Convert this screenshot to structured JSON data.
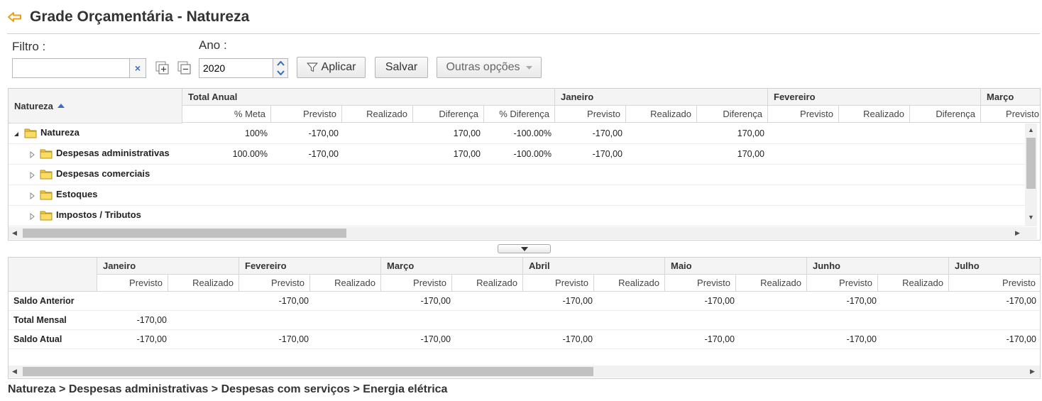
{
  "header": {
    "title": "Grade Orçamentária - Natureza",
    "back_icon": "back-arrow-icon"
  },
  "toolbar": {
    "filter_label": "Filtro :",
    "filter_value": "",
    "clear_glyph": "×",
    "year_label": "Ano :",
    "year_value": "2020",
    "apply_label": "Aplicar",
    "save_label": "Salvar",
    "other_label": "Outras opções"
  },
  "top_grid": {
    "col_natureza": "Natureza",
    "months": [
      "Total Anual",
      "Janeiro",
      "Fevereiro",
      "Março"
    ],
    "sub_total": [
      "% Meta",
      "Previsto",
      "Realizado",
      "Diferença",
      "% Diferença"
    ],
    "sub_month": [
      "Previsto",
      "Realizado",
      "Diferença"
    ],
    "rows": [
      {
        "label": "Natureza",
        "meta": "100%",
        "previsto": "-170,00",
        "realizado": "",
        "diferenca": "170,00",
        "pct_dif": "-100.00%",
        "jan_prev": "-170,00",
        "jan_real": "",
        "jan_dif": "170,00"
      },
      {
        "label": "Despesas administrativas",
        "meta": "100.00%",
        "previsto": "-170,00",
        "realizado": "",
        "diferenca": "170,00",
        "pct_dif": "-100.00%",
        "jan_prev": "-170,00",
        "jan_real": "",
        "jan_dif": "170,00"
      },
      {
        "label": "Despesas comerciais",
        "meta": "",
        "previsto": "",
        "realizado": "",
        "diferenca": "",
        "pct_dif": "",
        "jan_prev": "",
        "jan_real": "",
        "jan_dif": ""
      },
      {
        "label": "Estoques",
        "meta": "",
        "previsto": "",
        "realizado": "",
        "diferenca": "",
        "pct_dif": "",
        "jan_prev": "",
        "jan_real": "",
        "jan_dif": ""
      },
      {
        "label": "Impostos / Tributos",
        "meta": "",
        "previsto": "",
        "realizado": "",
        "diferenca": "",
        "pct_dif": "",
        "jan_prev": "",
        "jan_real": "",
        "jan_dif": ""
      }
    ]
  },
  "bottom_grid": {
    "months": [
      "Janeiro",
      "Fevereiro",
      "Março",
      "Abril",
      "Maio",
      "Junho",
      "Julho"
    ],
    "sub_prev": "Previsto",
    "sub_real": "Realizado",
    "rows": [
      {
        "label": "Saldo Anterior",
        "values": [
          "",
          "-170,00",
          "-170,00",
          "-170,00",
          "-170,00",
          "-170,00",
          "-170,00"
        ]
      },
      {
        "label": "Total Mensal",
        "values": [
          "-170,00",
          "",
          "",
          "",
          "",
          "",
          ""
        ]
      },
      {
        "label": "Saldo Atual",
        "values": [
          "-170,00",
          "-170,00",
          "-170,00",
          "-170,00",
          "-170,00",
          "-170,00",
          "-170,00"
        ]
      }
    ]
  },
  "breadcrumb": "Natureza > Despesas administrativas > Despesas com serviços > Energia elétrica",
  "colors": {
    "accent_orange": "#e8a317",
    "folder_yellow": "#f3c93a",
    "clear_blue": "#3b6ec5"
  }
}
